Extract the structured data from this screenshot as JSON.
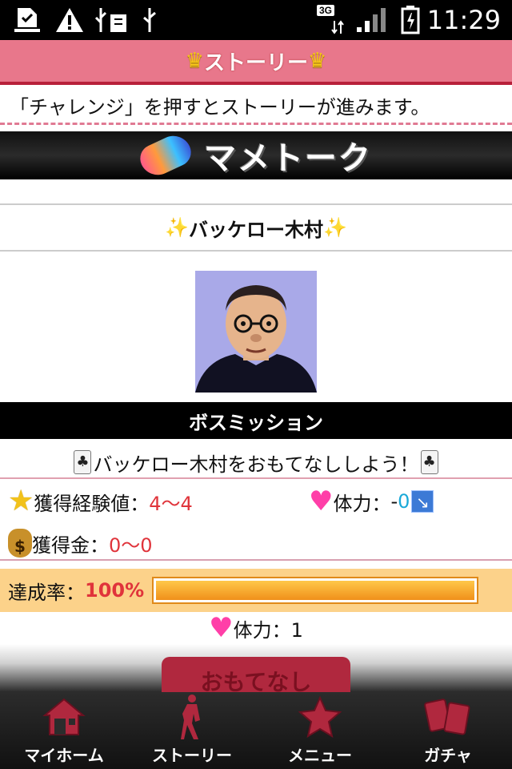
{
  "status_bar": {
    "time": "11:29",
    "network": "3G",
    "icons": [
      "download-done-icon",
      "warning-icon",
      "usb-debug-icon",
      "usb-icon",
      "signal-icon",
      "battery-icon"
    ]
  },
  "header": {
    "title": "ストーリー"
  },
  "info_text": "「チャレンジ」を押すとストーリーが進みます。",
  "banner": {
    "text": "マメトーク"
  },
  "boss": {
    "name": "バッケロー木村"
  },
  "mission": {
    "label": "ボスミッション",
    "description": "バッケロー木村をおもてなししよう！"
  },
  "stats": {
    "exp_label": "獲得経験値：",
    "exp_value": "4〜4",
    "stamina_label": "体力：",
    "stamina_prefix": "-",
    "stamina_value": "0",
    "gold_label": "獲得金：",
    "gold_value": "0〜0"
  },
  "achievement": {
    "label": "達成率：",
    "value": "100%",
    "progress": 1.0
  },
  "cost": {
    "label": "体力：1"
  },
  "action_button": {
    "label": "おもてなし"
  },
  "tabs": [
    {
      "label": "マイホーム",
      "icon": "home-icon"
    },
    {
      "label": "ストーリー",
      "icon": "walking-person-icon"
    },
    {
      "label": "メニュー",
      "icon": "star-icon"
    },
    {
      "label": "ガチャ",
      "icon": "cards-icon"
    }
  ],
  "colors": {
    "accent_pink": "#e8778b",
    "accent_dark": "#b0283e",
    "progress_orange": "#f0901a",
    "value_red": "#e0343b"
  }
}
